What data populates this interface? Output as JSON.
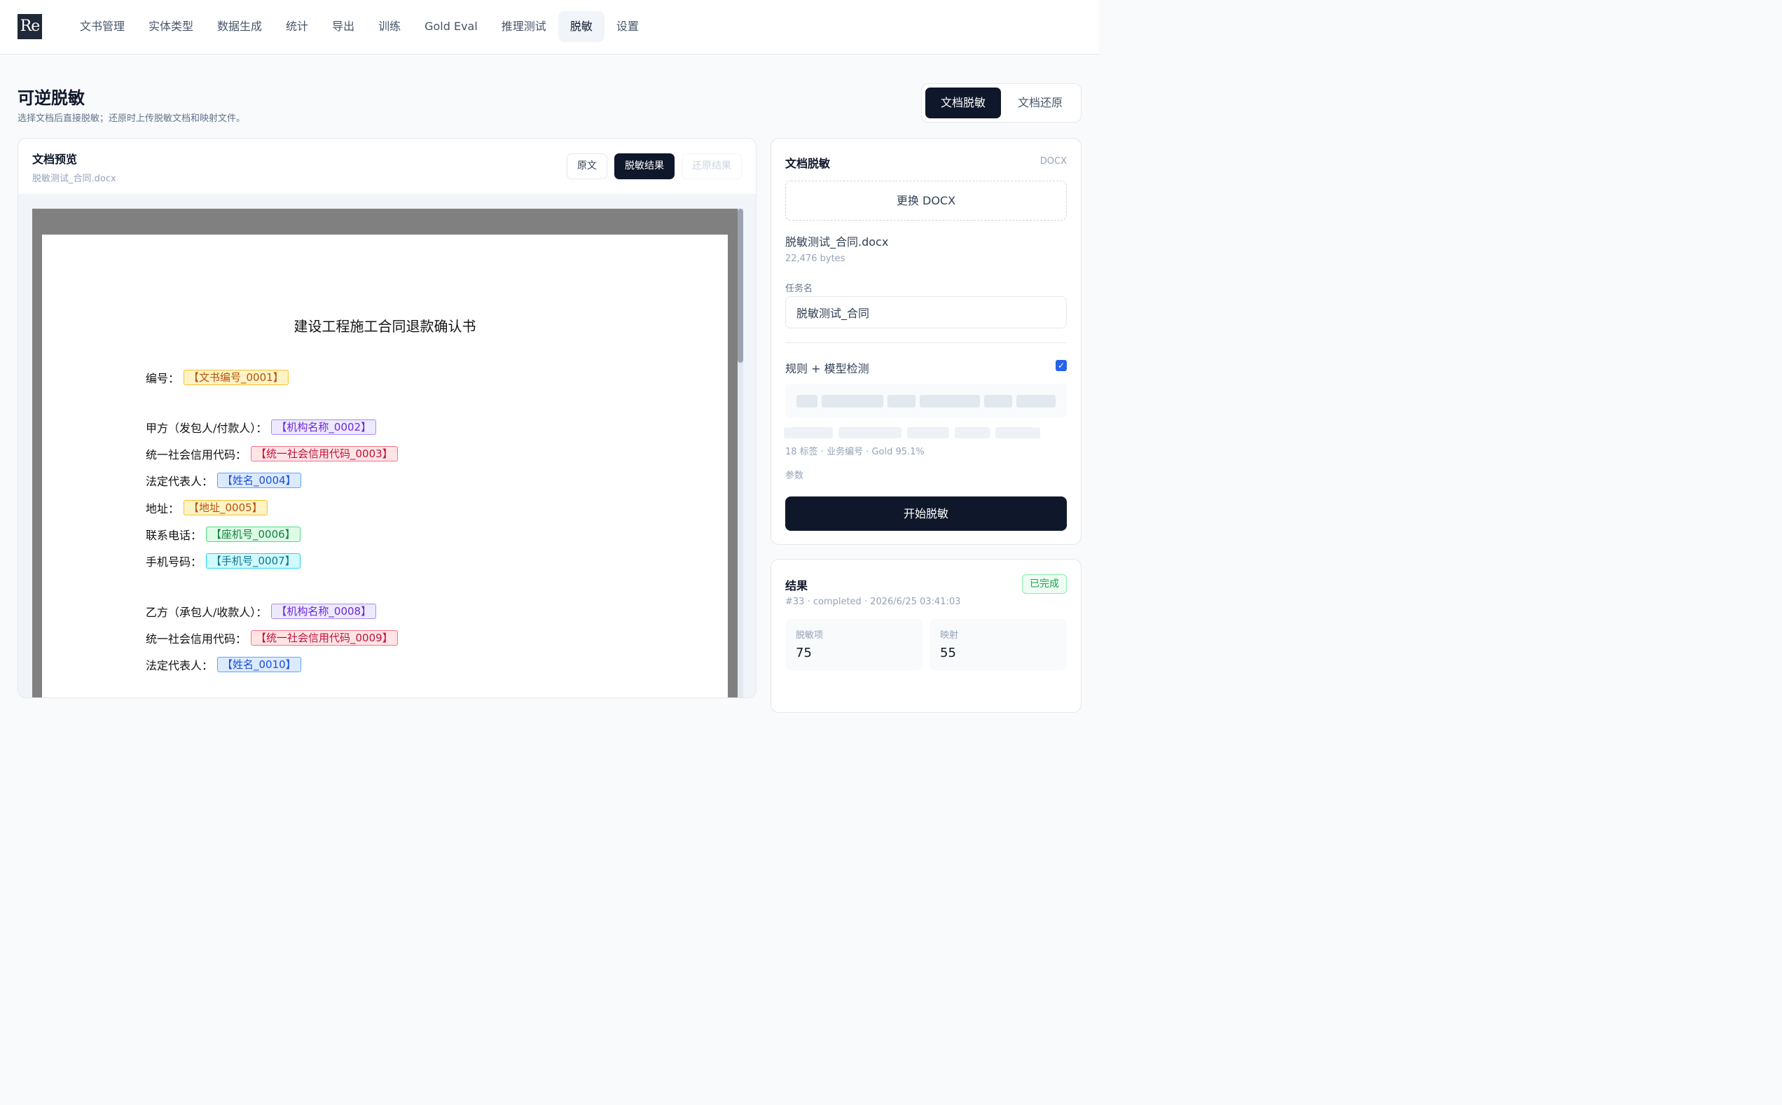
{
  "logo": "Re",
  "nav": [
    {
      "label": "文书管理",
      "active": false
    },
    {
      "label": "实体类型",
      "active": false
    },
    {
      "label": "数据生成",
      "active": false
    },
    {
      "label": "统计",
      "active": false
    },
    {
      "label": "导出",
      "active": false
    },
    {
      "label": "训练",
      "active": false
    },
    {
      "label": "Gold Eval",
      "active": false
    },
    {
      "label": "推理测试",
      "active": false
    },
    {
      "label": "脱敏",
      "active": true
    },
    {
      "label": "设置",
      "active": false
    }
  ],
  "header": {
    "title": "可逆脱敏",
    "subtitle": "选择文档后直接脱敏；还原时上传脱敏文档和映射文件。",
    "mode_active": "文档脱敏",
    "mode_other": "文档还原"
  },
  "preview": {
    "title": "文档预览",
    "file": "脱敏测试_合同.docx",
    "btn_original": "原文",
    "btn_masked": "脱敏结果",
    "btn_restored": "还原结果",
    "doc_title": "建设工程施工合同退款确认书",
    "lines": [
      {
        "label": "编号：",
        "tag": "【文书编号_0001】",
        "color": "orange"
      },
      {
        "label": "甲方（发包人/付款人）：",
        "tag": "【机构名称_0002】",
        "color": "purple"
      },
      {
        "label": "统一社会信用代码：",
        "tag": "【统一社会信用代码_0003】",
        "color": "red"
      },
      {
        "label": "法定代表人：",
        "tag": "【姓名_0004】",
        "color": "blue"
      },
      {
        "label": "地址：",
        "tag": "【地址_0005】",
        "color": "orange"
      },
      {
        "label": "联系电话：",
        "tag": "【座机号_0006】",
        "color": "green"
      },
      {
        "label": "手机号码：",
        "tag": "【手机号_0007】",
        "color": "cyan"
      },
      {
        "label": "乙方（承包人/收款人）：",
        "tag": "【机构名称_0008】",
        "color": "purple"
      },
      {
        "label": "统一社会信用代码：",
        "tag": "【统一社会信用代码_0009】",
        "color": "red"
      },
      {
        "label": "法定代表人：",
        "tag": "【姓名_0010】",
        "color": "blue"
      }
    ]
  },
  "mask_panel": {
    "title": "文档脱敏",
    "format": "DOCX",
    "replace_button": "更换 DOCX",
    "file_name": "脱敏测试_合同.docx",
    "file_size": "22,476 bytes",
    "task_label": "任务名",
    "task_value": "脱敏测试_合同",
    "rule_label": "规则 + 模型检测",
    "rule_checked": true,
    "model_meta": "18 标签 · 业务编号 · Gold 95.1%",
    "params_label": "参数",
    "start_button": "开始脱敏"
  },
  "result": {
    "title": "结果",
    "status": "已完成",
    "meta": "#33 · completed · 2026/6/25 03:41:03",
    "stats": [
      {
        "label": "脱敏项",
        "value": "75"
      },
      {
        "label": "映射",
        "value": "55"
      }
    ]
  },
  "colors": {
    "primary": "#0f172a",
    "accent": "#2563eb",
    "success": "#16a34a"
  }
}
